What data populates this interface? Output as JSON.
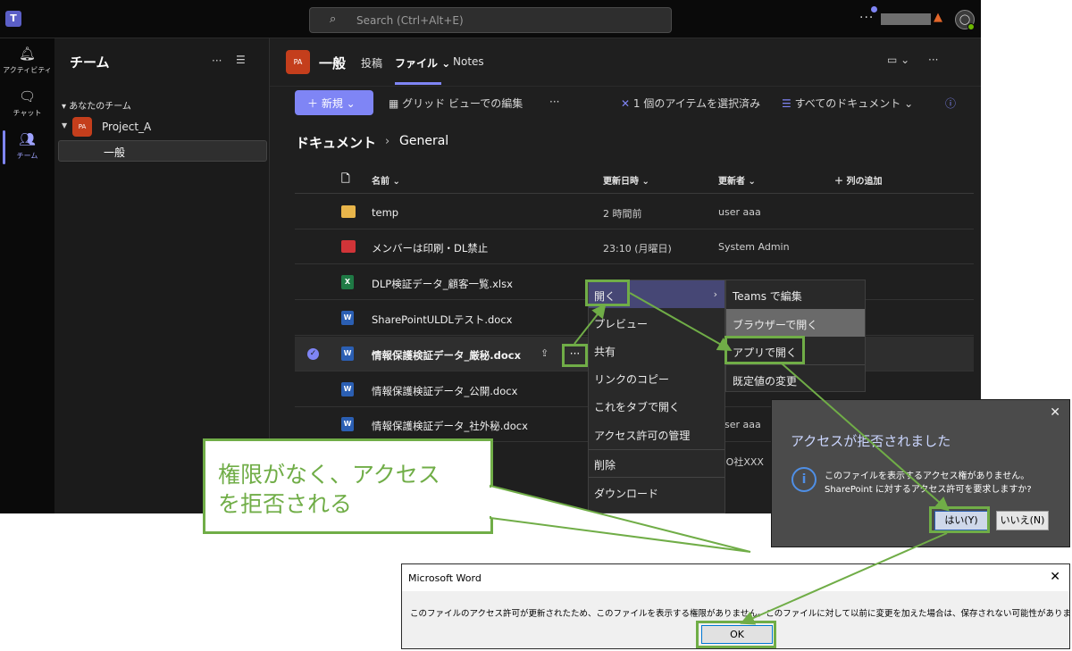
{
  "topbar": {
    "logo": "T",
    "search_placeholder": "Search (Ctrl+Alt+E)",
    "more": "···"
  },
  "rail": [
    {
      "icon": "bell-icon",
      "glyph": "🔔",
      "label": "アクティビティ"
    },
    {
      "icon": "chat-icon",
      "glyph": "💬",
      "label": "チャット"
    },
    {
      "icon": "teams-icon",
      "glyph": "👥",
      "label": "チーム"
    }
  ],
  "teamlist": {
    "title": "チーム",
    "more": "···",
    "section": "あなたのチーム",
    "team_avatar": "PA",
    "team_name": "Project_A",
    "channel": "一般"
  },
  "channel": {
    "avatar": "PA",
    "name": "一般",
    "tabs": [
      "投稿",
      "ファイル",
      "Notes"
    ],
    "more": "···"
  },
  "toolbar": {
    "new_label": "新規",
    "grid_edit": "グリッド ビューでの編集",
    "more": "···",
    "selected": "1 個のアイテムを選択済み",
    "view": "すべてのドキュメント",
    "info": "ⓘ"
  },
  "breadcrumb": {
    "root": "ドキュメント",
    "sep": "›",
    "current": "General"
  },
  "columns": {
    "name": "名前",
    "modified": "更新日時",
    "modified_by": "更新者",
    "add_column": "列の追加"
  },
  "files": [
    {
      "name": "temp",
      "type": "folder",
      "modified": "2 時間前",
      "by": "user aaa"
    },
    {
      "name": "メンバーは印刷・DL禁止",
      "type": "folder-red",
      "modified": "23:10 (月曜日)",
      "by": "System Admin"
    },
    {
      "name": "DLP検証データ_顧客一覧.xlsx",
      "type": "xlsx",
      "modified": "",
      "by": ""
    },
    {
      "name": "SharePointULDLテスト.docx",
      "type": "docx",
      "modified": "",
      "by": ""
    },
    {
      "name": "情報保護検証データ_厳秘.docx",
      "type": "docx",
      "modified": "",
      "by": "",
      "selected": true
    },
    {
      "name": "情報保護検証データ_公開.docx",
      "type": "docx",
      "modified": "",
      "by": ""
    },
    {
      "name": "情報保護検証データ_社外秘.docx",
      "type": "docx",
      "modified": "",
      "by": "user aaa"
    },
    {
      "name": "",
      "type": "",
      "modified": "",
      "by": "OO社XXX"
    }
  ],
  "row_more": "···",
  "context_menu": [
    "開く",
    "プレビュー",
    "共有",
    "リンクのコピー",
    "これをタブで開く",
    "アクセス許可の管理",
    "削除",
    "ダウンロード"
  ],
  "submenu": [
    "Teams で編集",
    "ブラウザーで開く",
    "アプリで開く",
    "既定値の変更"
  ],
  "access_dialog": {
    "title": "アクセスが拒否されました",
    "line1": "このファイルを表示するアクセス権がありません。",
    "line2": "SharePoint に対するアクセス許可を要求しますか?",
    "yes": "はい(Y)",
    "no": "いいえ(N)",
    "close": "✕"
  },
  "word_dialog": {
    "title": "Microsoft Word",
    "message": "このファイルのアクセス許可が更新されたため、このファイルを表示する権限がありません。このファイルに対して以前に変更を加えた場合は、保存されない可能性があります。",
    "ok": "OK",
    "close": "✕"
  },
  "callout": {
    "line1": "権限がなく、アクセス",
    "line2": "を拒否される"
  },
  "colors": {
    "accent": "#7f85f5",
    "annotation": "#70ad47",
    "background": "#1f1f1f"
  }
}
